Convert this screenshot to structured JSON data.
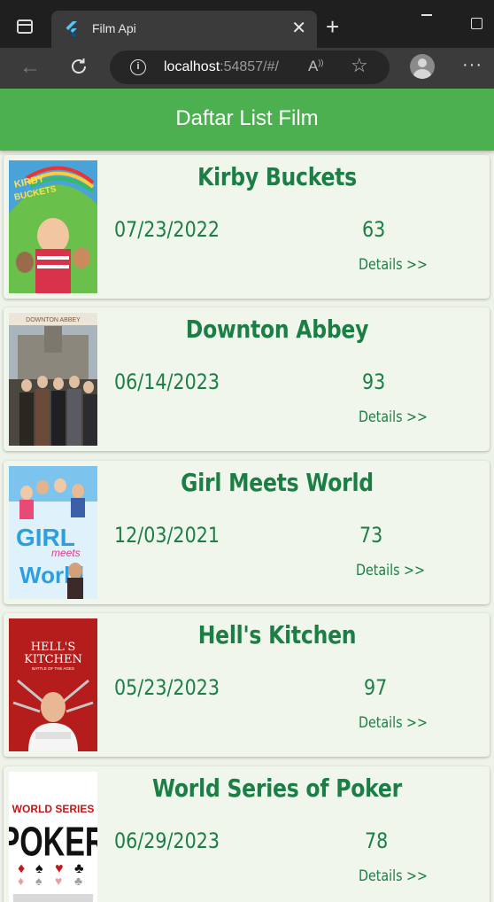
{
  "browser": {
    "tab_title": "Film Api",
    "url_host": "localhost",
    "url_rest": ":54857/#/",
    "read_aloud_label": "A)"
  },
  "app": {
    "title": "Daftar List Film"
  },
  "films": [
    {
      "title": "Kirby Buckets",
      "date": "07/23/2022",
      "score": "63",
      "details_label": "Details >>",
      "poster_text": "KIRBY BUCKETS"
    },
    {
      "title": "Downton Abbey",
      "date": "06/14/2023",
      "score": "93",
      "details_label": "Details >>",
      "poster_text": "DOWNTON ABBEY"
    },
    {
      "title": "Girl Meets World",
      "date": "12/03/2021",
      "score": "73",
      "details_label": "Details >>",
      "poster_text_1": "GIRL",
      "poster_text_2": "meets",
      "poster_text_3": "World"
    },
    {
      "title": "Hell's Kitchen",
      "date": "05/23/2023",
      "score": "97",
      "details_label": "Details >>",
      "poster_text_1": "HELL'S",
      "poster_text_2": "KITCHEN",
      "poster_text_3": "BATTLE OF THE AGES"
    },
    {
      "title": "World Series of Poker",
      "date": "06/29/2023",
      "score": "78",
      "details_label": "Details >>",
      "poster_text_1": "WORLD SERIES",
      "poster_text_2": "POKER"
    }
  ],
  "colors": {
    "appbar": "#4caf50",
    "accent_text": "#1b7f45",
    "card_bg": "#f1f6ec"
  }
}
